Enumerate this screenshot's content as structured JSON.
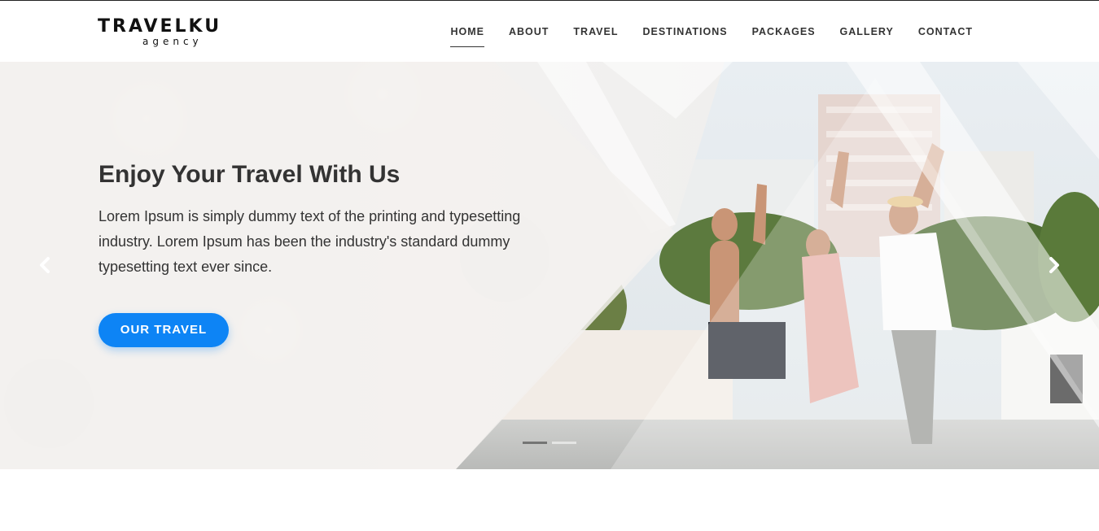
{
  "brand": {
    "name": "TRAVELKU",
    "tagline": "agency"
  },
  "nav": {
    "items": [
      {
        "label": "HOME",
        "active": true
      },
      {
        "label": "ABOUT",
        "active": false
      },
      {
        "label": "TRAVEL",
        "active": false
      },
      {
        "label": "DESTINATIONS",
        "active": false
      },
      {
        "label": "PACKAGES",
        "active": false
      },
      {
        "label": "GALLERY",
        "active": false
      },
      {
        "label": "CONTACT",
        "active": false
      }
    ]
  },
  "hero": {
    "title": "Enjoy Your Travel With Us",
    "text": "Lorem Ipsum is simply dummy text of the printing and typesetting industry. Lorem Ipsum has been the industry's standard dummy typesetting text ever since.",
    "button_label": "OUR TRAVEL",
    "prev_icon": "chevron-left-icon",
    "next_icon": "chevron-right-icon",
    "slides_total": 2,
    "active_slide": 1
  },
  "colors": {
    "accent": "#0d84f5",
    "text": "#333333",
    "header_bg": "#ffffff"
  }
}
